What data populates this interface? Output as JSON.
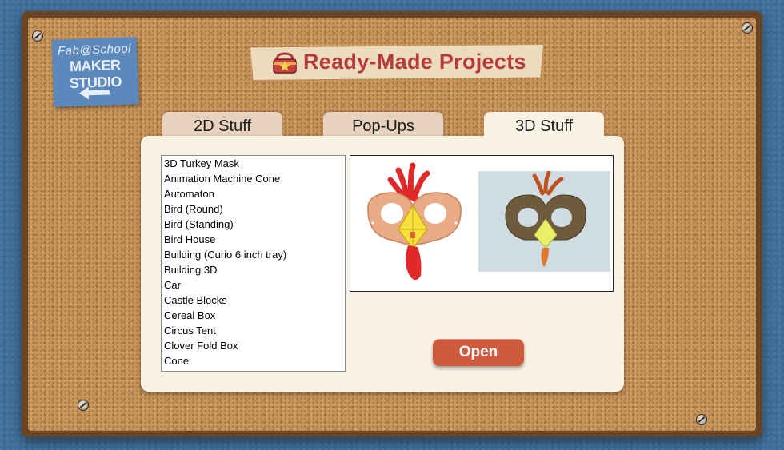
{
  "logo": {
    "line1": "Fab@School",
    "line2": "MAKER STUDIO"
  },
  "header": {
    "title": "Ready-Made Projects"
  },
  "tabs": [
    {
      "label": "2D Stuff",
      "active": false
    },
    {
      "label": "Pop-Ups",
      "active": false
    },
    {
      "label": "3D Stuff",
      "active": true
    }
  ],
  "project_list": [
    "3D Turkey Mask",
    "Animation Machine Cone",
    "Automaton",
    "Bird (Round)",
    "Bird (Standing)",
    "Bird House",
    "Building (Curio 6 inch tray)",
    "Building 3D",
    "Car",
    "Castle Blocks",
    "Cereal Box",
    "Circus Tent",
    "Clover Fold Box",
    "Cone"
  ],
  "actions": {
    "open_label": "Open"
  },
  "icons": {
    "back": "back-arrow-icon",
    "box": "treasure-box-icon"
  },
  "colors": {
    "accent": "#cf5a3e",
    "title": "#b53b3b",
    "logo": "#5b89bc"
  }
}
